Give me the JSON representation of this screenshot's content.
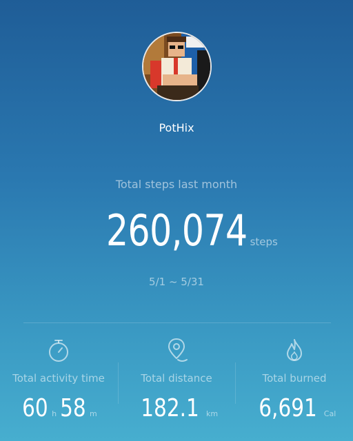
{
  "profile": {
    "username": "PotHix",
    "avatar_icon": "pixel-art-avatar"
  },
  "summary": {
    "label": "Total steps last month",
    "steps_value": "260,074",
    "steps_unit": "steps",
    "date_range": "5/1 ~ 5/31"
  },
  "stats": {
    "activity": {
      "icon": "stopwatch-icon",
      "label": "Total activity time",
      "hours": "60",
      "hours_unit": "h",
      "minutes": "58",
      "minutes_unit": "m"
    },
    "distance": {
      "icon": "location-pin-icon",
      "label": "Total distance",
      "value": "182.1",
      "unit": "km"
    },
    "burned": {
      "icon": "flame-icon",
      "label": "Total burned",
      "value": "6,691",
      "unit": "Cal"
    }
  },
  "colors": {
    "background_top": "#1f5d97",
    "background_bottom": "#47aecf",
    "text_primary": "#ffffff"
  }
}
